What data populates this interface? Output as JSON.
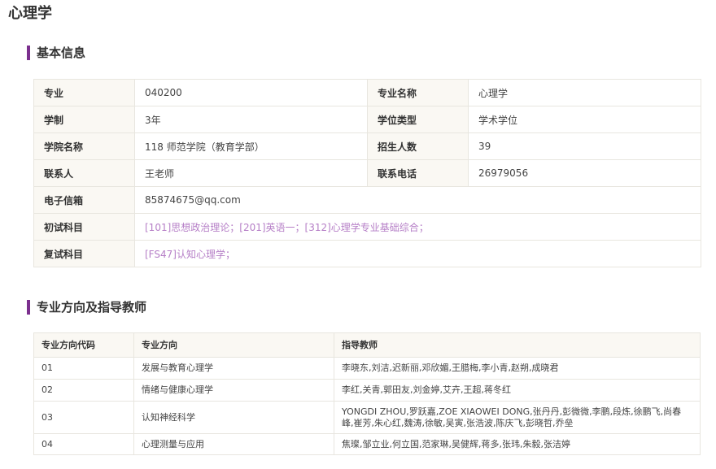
{
  "page_title": "心理学",
  "accent_color": "#7b2f8e",
  "link_color": "#b67fc7",
  "basic": {
    "heading": "基本信息",
    "major_label": "专业",
    "major_value": "040200",
    "major_name_label": "专业名称",
    "major_name_value": "心理学",
    "duration_label": "学制",
    "duration_value": "3年",
    "degree_label": "学位类型",
    "degree_value": "学术学位",
    "college_label": "学院名称",
    "college_value": "118 师范学院（教育学部）",
    "enroll_label": "招生人数",
    "enroll_value": "39",
    "contact_label": "联系人",
    "contact_value": "王老师",
    "phone_label": "联系电话",
    "phone_value": "26979056",
    "email_label": "电子信箱",
    "email_value": "85874675@qq.com",
    "prelim_label": "初试科目",
    "prelim_value": "[101]思想政治理论；[201]英语一；[312]心理学专业基础综合；",
    "retest_label": "复试科目",
    "retest_value": "[FS47]认知心理学；"
  },
  "directions": {
    "heading": "专业方向及指导教师",
    "columns": [
      "专业方向代码",
      "专业方向",
      "指导教师"
    ],
    "rows": [
      {
        "code": "01",
        "name": "发展与教育心理学",
        "teachers": "李晓东,刘洁,迟新丽,邓欣媚,王腊梅,李小青,赵朔,成晓君"
      },
      {
        "code": "02",
        "name": "情绪与健康心理学",
        "teachers": "李红,关青,郭田友,刘金婷,艾卉,王超,蒋冬红"
      },
      {
        "code": "03",
        "name": "认知神经科学",
        "teachers": "YONGDI ZHOU,罗跃嘉,ZOE XIAOWEI DONG,张丹丹,彭微微,李鹏,段炼,徐鹏飞,尚春峰,崔芳,朱心红,魏涛,徐敏,吴寅,张浩波,陈庆飞,彭晓哲,乔垒"
      },
      {
        "code": "04",
        "name": "心理测量与应用",
        "teachers": "焦璨,邹立业,何立国,范家琳,吴健辉,蒋多,张玮,朱毅,张洁婷"
      }
    ]
  }
}
